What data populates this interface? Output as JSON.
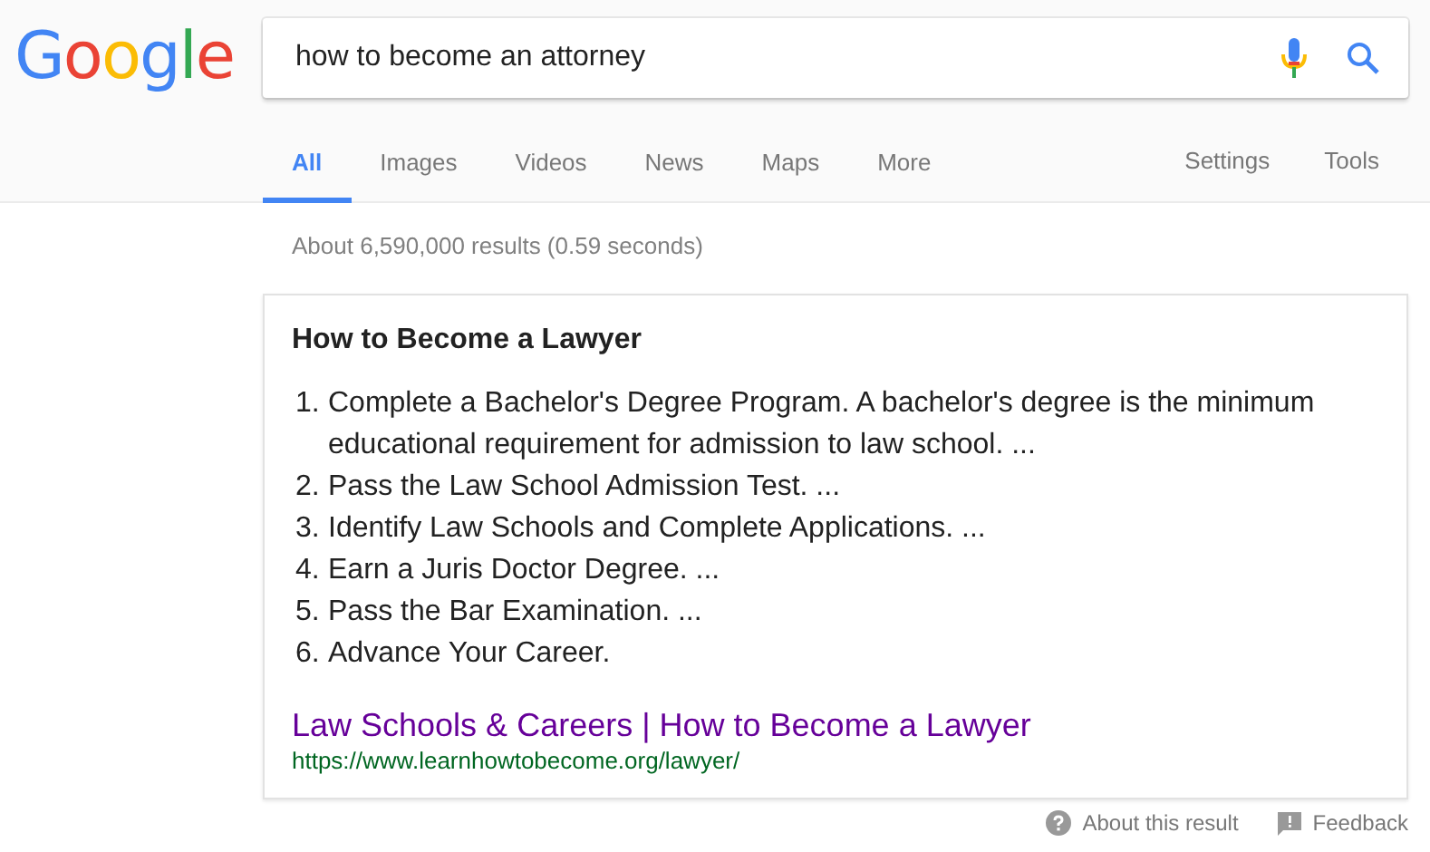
{
  "logo": "Google",
  "search": {
    "value": "how to become an attorney"
  },
  "tabs": [
    {
      "label": "All",
      "selected": true
    },
    {
      "label": "Images",
      "selected": false
    },
    {
      "label": "Videos",
      "selected": false
    },
    {
      "label": "News",
      "selected": false
    },
    {
      "label": "Maps",
      "selected": false
    },
    {
      "label": "More",
      "selected": false
    }
  ],
  "tools": [
    "Settings",
    "Tools"
  ],
  "result_stats": "About 6,590,000 results (0.59 seconds)",
  "snippet": {
    "title": "How to Become a Lawyer",
    "steps": [
      {
        "number": "1.",
        "text": "Complete a Bachelor's Degree Program. A bachelor's degree is the minimum educational requirement for admission to law school. ..."
      },
      {
        "number": "2.",
        "text": "Pass the Law School Admission Test. ..."
      },
      {
        "number": "3.",
        "text": "Identify Law Schools and Complete Applications. ..."
      },
      {
        "number": "4.",
        "text": "Earn a Juris Doctor Degree. ..."
      },
      {
        "number": "5.",
        "text": "Pass the Bar Examination. ..."
      },
      {
        "number": "6.",
        "text": "Advance Your Career."
      }
    ],
    "link_title": "Law Schools & Careers | How to Become a Lawyer",
    "url": "https://www.learnhowtobecome.org/lawyer/"
  },
  "footer": {
    "about": "About this result",
    "feedback": "Feedback"
  }
}
